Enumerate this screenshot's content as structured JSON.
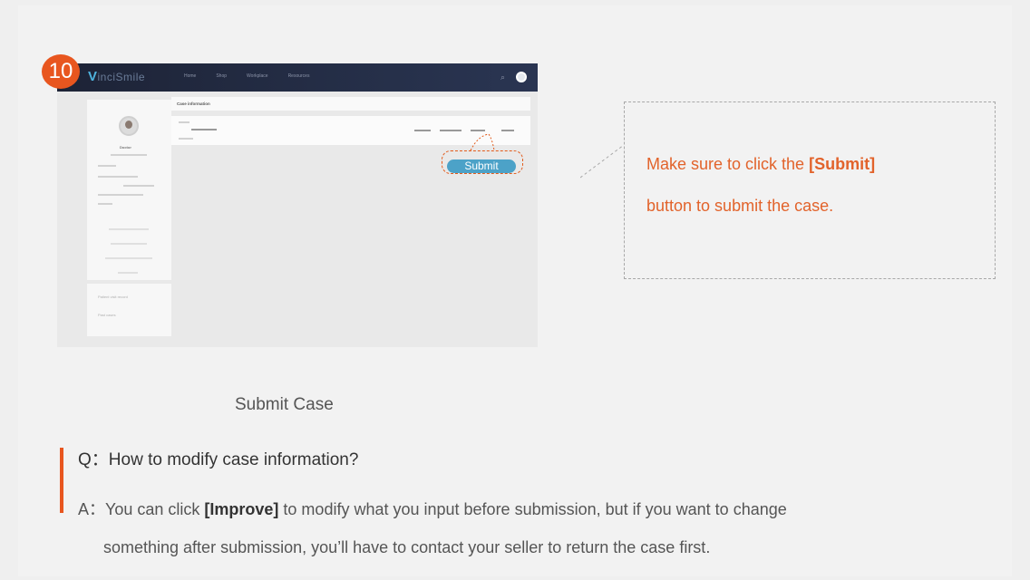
{
  "screenshot": {
    "step_number": "10",
    "logo_initial": "V",
    "logo_rest": "inciSmile",
    "nav_items": [
      "Home",
      "Shop",
      "Workplace",
      "Resources"
    ],
    "profile_name": "Doctor",
    "case_info_header": "Case information",
    "submit_button": "Submit",
    "sidebar_links": [
      "Patient visit record",
      "Past cases"
    ]
  },
  "callout": {
    "line1_prefix": "Make sure to click the ",
    "line1_bold": "[Submit]",
    "line2": "button to submit the case."
  },
  "caption": "Submit Case",
  "qa": {
    "question": "Q：How to modify case information?",
    "answer_prefix": "A：You can click ",
    "answer_bold": "[Improve]",
    "answer_suffix": " to modify what you input before submission, but if you want to change",
    "answer_line2": "something after submission, you’ll have to contact your seller to return the case first."
  },
  "colors": {
    "accent": "#e8561f",
    "callout_text": "#e2632b",
    "button_blue": "#4ca2c8",
    "navbar": "#1d2336"
  }
}
